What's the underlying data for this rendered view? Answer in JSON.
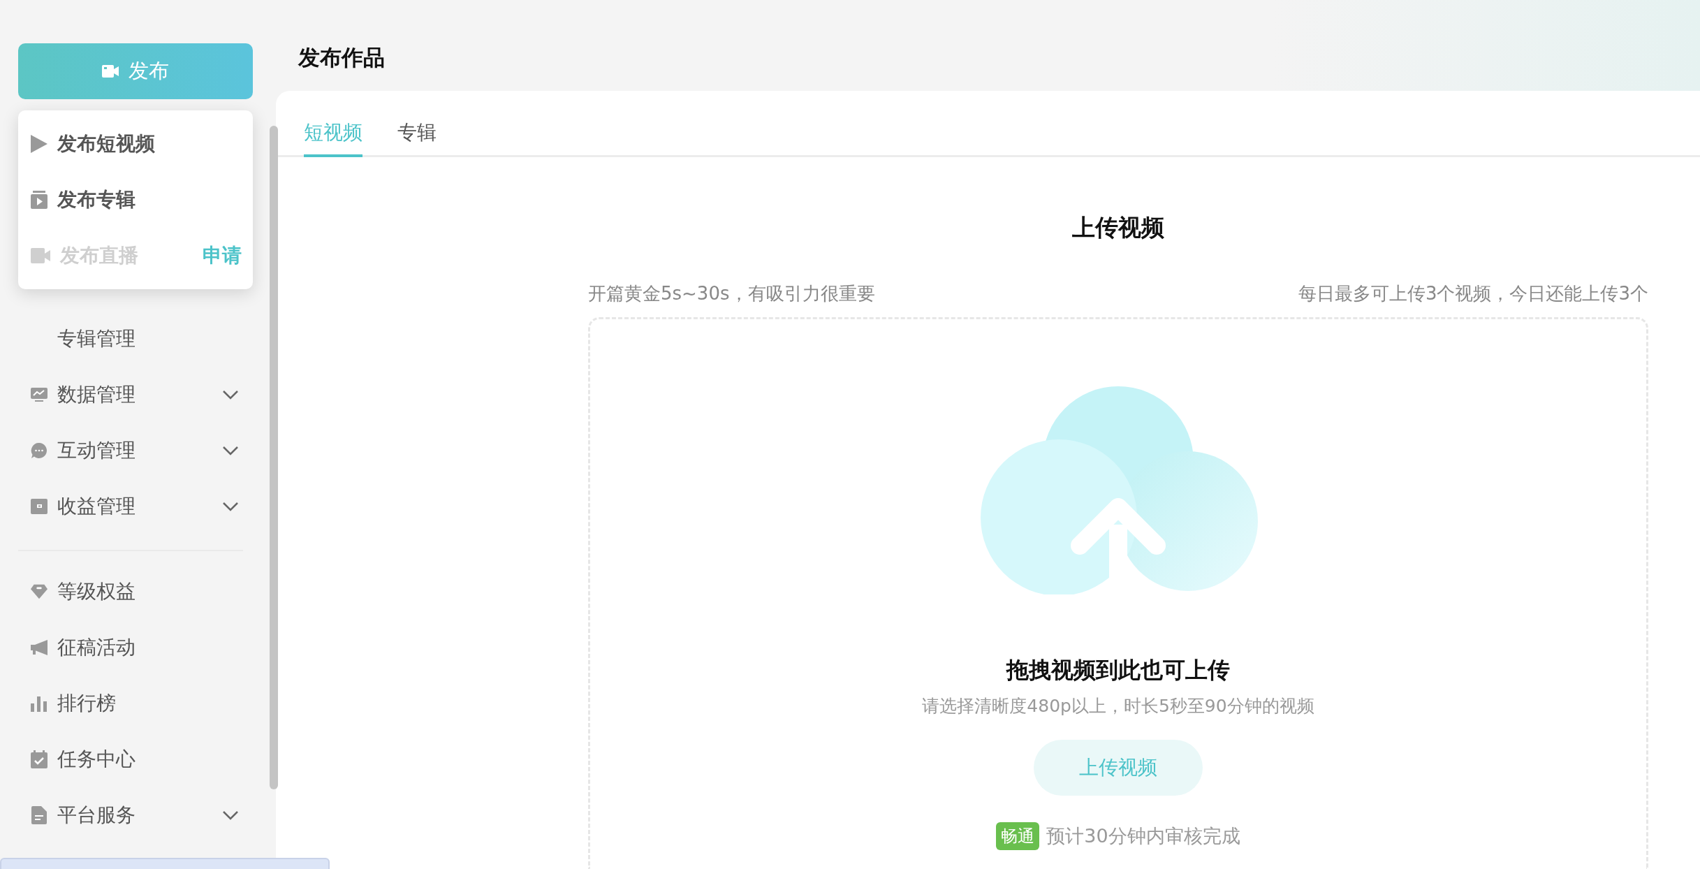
{
  "publish_button": {
    "label": "发布"
  },
  "publish_menu": {
    "items": [
      {
        "label": "发布短视频",
        "kind": "video",
        "disabled": false
      },
      {
        "label": "发布专辑",
        "kind": "album",
        "disabled": false
      },
      {
        "label": "发布直播",
        "kind": "live",
        "disabled": true,
        "action": "申请"
      }
    ]
  },
  "sidebar": {
    "groups": [
      {
        "items": [
          {
            "label": "专辑管理",
            "expandable": false
          },
          {
            "label": "数据管理",
            "expandable": true
          },
          {
            "label": "互动管理",
            "expandable": true
          },
          {
            "label": "收益管理",
            "expandable": true
          }
        ]
      },
      {
        "items": [
          {
            "label": "等级权益",
            "expandable": false
          },
          {
            "label": "征稿活动",
            "expandable": false
          },
          {
            "label": "排行榜",
            "expandable": false
          },
          {
            "label": "任务中心",
            "expandable": false
          },
          {
            "label": "平台服务",
            "expandable": true
          }
        ]
      }
    ]
  },
  "page_title": "发布作品",
  "tabs": [
    {
      "label": "短视频",
      "selected": true
    },
    {
      "label": "专辑",
      "selected": false
    }
  ],
  "upload": {
    "heading": "上传视频",
    "hint_left": "开篇黄金5s~30s，有吸引力很重要",
    "hint_right": "每日最多可上传3个视频，今日还能上传3个",
    "drop_title": "拖拽视频到此也可上传",
    "drop_hint": "请选择清晰度480p以上，时长5秒至90分钟的视频",
    "button": "上传视频",
    "badge": "畅通",
    "eta": "预计30分钟内审核完成"
  }
}
